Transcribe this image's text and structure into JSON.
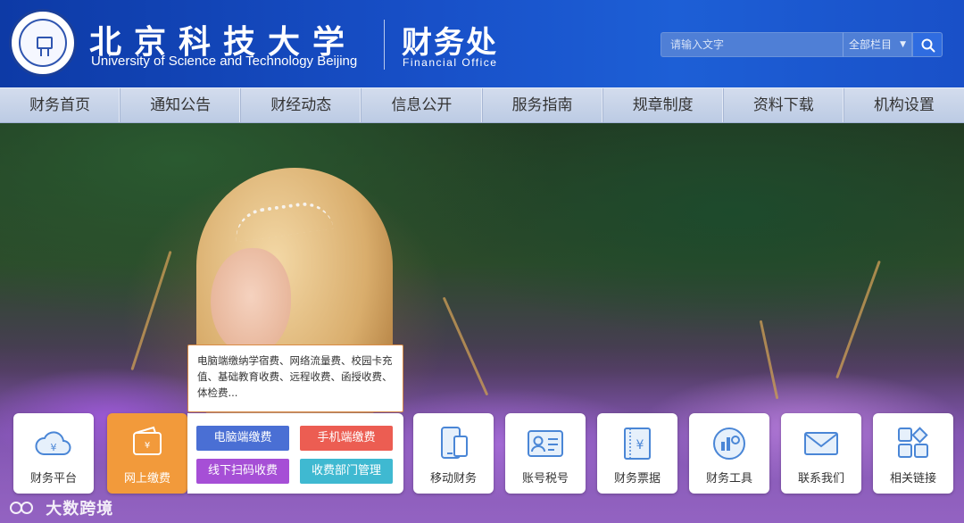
{
  "header": {
    "school_name_cn": "北京科技大学",
    "school_name_en": "University of Science and Technology Beijing",
    "office_name_cn": "财务处",
    "office_name_en": "Financial  Office",
    "search": {
      "placeholder": "请输入文字",
      "scope_selected": "全部栏目",
      "button_icon": "search-icon"
    }
  },
  "nav": {
    "items": [
      {
        "label": "财务首页"
      },
      {
        "label": "通知公告"
      },
      {
        "label": "财经动态"
      },
      {
        "label": "信息公开"
      },
      {
        "label": "服务指南"
      },
      {
        "label": "规章制度"
      },
      {
        "label": "资料下载"
      },
      {
        "label": "机构设置"
      }
    ]
  },
  "popup": {
    "text": "电脑端缴纳学宿费、网络流量费、校园卡充值、基础教育收费、远程收费、函授收费、体检费..."
  },
  "tiles": [
    {
      "label": "财务平台",
      "icon": "cloud-yen-icon"
    },
    {
      "label": "网上缴费",
      "icon": "wallet-icon",
      "active": true
    },
    {
      "label": "移动财务",
      "icon": "mobile-icon"
    },
    {
      "label": "账号税号",
      "icon": "id-card-icon"
    },
    {
      "label": "财务票据",
      "icon": "receipt-yen-icon"
    },
    {
      "label": "财务工具",
      "icon": "calculator-icon"
    },
    {
      "label": "联系我们",
      "icon": "mail-icon"
    },
    {
      "label": "相关链接",
      "icon": "grid-links-icon"
    }
  ],
  "payment_options": [
    {
      "label": "电脑端缴费",
      "color": "#4a6fd4"
    },
    {
      "label": "手机端缴费",
      "color": "#ec5d52"
    },
    {
      "label": "线下扫码收费",
      "color": "#a64fd6"
    },
    {
      "label": "收费部门管理",
      "color": "#3fb9d1"
    }
  ],
  "watermark": {
    "text": "大数跨境",
    "icon": "watermark-logo-icon"
  },
  "colors": {
    "header_blue": "#1850c8",
    "nav_bg": "#c6d3ea",
    "active_tile": "#f29a3b"
  }
}
